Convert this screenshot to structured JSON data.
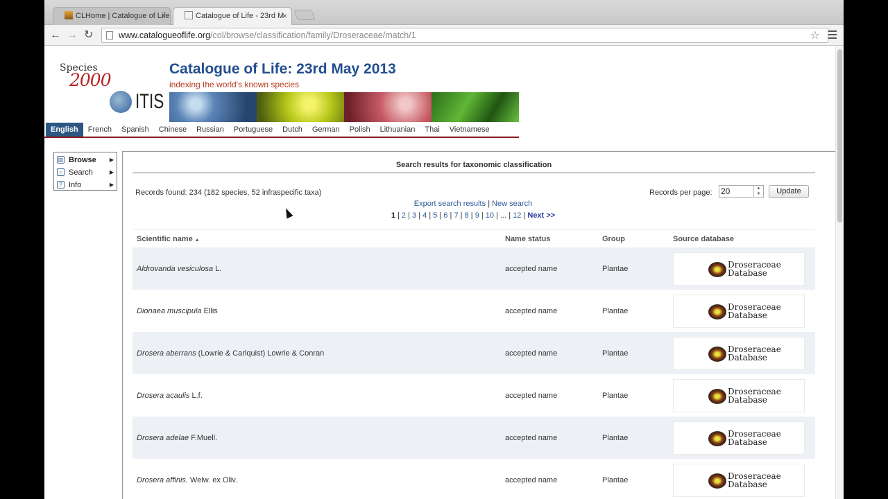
{
  "browser": {
    "tabs": [
      {
        "title": "CLHome | Catalogue of Life",
        "close": "×"
      },
      {
        "title": "Catalogue of Life - 23rd M",
        "close": "×"
      }
    ],
    "url_host": "www.catalogueoflife.org",
    "url_path": "/col/browse/classification/family/Droseraceae/match/1"
  },
  "header": {
    "logo_species": "Species",
    "logo_2000": "2000",
    "logo_itis": "ITIS",
    "title": "Catalogue of Life: 23rd May 2013",
    "tagline": "indexing the world's known species"
  },
  "languages": [
    "English",
    "French",
    "Spanish",
    "Chinese",
    "Russian",
    "Portuguese",
    "Dutch",
    "German",
    "Polish",
    "Lithuanian",
    "Thai",
    "Vietnamese"
  ],
  "sidebar": {
    "items": [
      {
        "label": "Browse",
        "icon": "book-icon"
      },
      {
        "label": "Search",
        "icon": "search-icon"
      },
      {
        "label": "Info",
        "icon": "help-icon"
      }
    ]
  },
  "results": {
    "title": "Search results for taxonomic classification",
    "records_found": "Records found: 234 (182 species, 52 infraspecific taxa)",
    "rpp_label": "Records per page:",
    "rpp_value": "20",
    "update_label": "Update",
    "export_link": "Export search results",
    "new_search_link": "New search",
    "pages": [
      "1",
      "2",
      "3",
      "4",
      "5",
      "6",
      "7",
      "8",
      "9",
      "10",
      "...",
      "12"
    ],
    "next_label": "Next >>",
    "columns": [
      "Scientific name",
      "Name status",
      "Group",
      "Source database"
    ],
    "rows": [
      {
        "genus_species": "Aldrovanda vesiculosa",
        "author": "L.",
        "status": "accepted name",
        "group": "Plantae"
      },
      {
        "genus_species": "Dionaea muscipula",
        "author": "Ellis",
        "status": "accepted name",
        "group": "Plantae"
      },
      {
        "genus_species": "Drosera aberrans",
        "author": "(Lowrie & Carlquist) Lowrie & Conran",
        "status": "accepted name",
        "group": "Plantae"
      },
      {
        "genus_species": "Drosera acaulis",
        "author": "L.f.",
        "status": "accepted name",
        "group": "Plantae"
      },
      {
        "genus_species": "Drosera adelae",
        "author": "F.Muell.",
        "status": "accepted name",
        "group": "Plantae"
      },
      {
        "genus_species": "Drosera affinis.",
        "author": "Welw. ex Oliv.",
        "status": "accepted name",
        "group": "Plantae"
      }
    ],
    "db_logo_line1": "Droseraceae",
    "db_logo_line2": "Database"
  }
}
